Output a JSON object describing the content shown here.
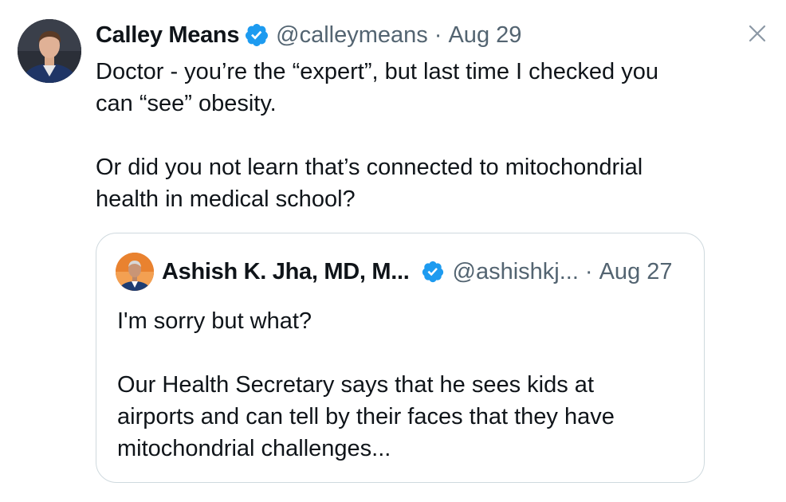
{
  "tweet": {
    "author": {
      "name": "Calley Means",
      "handle": "@calleymeans",
      "separator": "·",
      "date": "Aug 29"
    },
    "text": {
      "line1": "Doctor - you’re the “expert”, but last time I checked you",
      "line2": "can “see” obesity.",
      "line3": "Or did you not learn that’s connected to mitochondrial",
      "line4": "health in medical school?"
    },
    "icons": {
      "verified": "verified-badge-icon",
      "close": "close-icon"
    },
    "colors": {
      "verified": "#1d9bf0",
      "secondary_text": "#536471",
      "border": "#cfd9de"
    }
  },
  "quoted_tweet": {
    "author": {
      "name": "Ashish K. Jha, MD, M...",
      "handle": "@ashishkj...",
      "separator": "·",
      "date": "Aug 27"
    },
    "text": {
      "line1": "I'm sorry but what?",
      "line2": "Our Health Secretary says that he sees kids at",
      "line3": "airports and can tell by their faces that they have",
      "line4": "mitochondrial challenges..."
    }
  }
}
